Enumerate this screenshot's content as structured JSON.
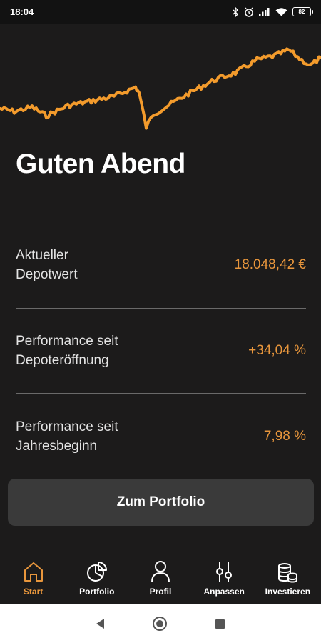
{
  "status_bar": {
    "time": "18:04",
    "battery": "82",
    "icons": [
      "bluetooth-icon",
      "alarm-icon",
      "signal-icon",
      "wifi-icon",
      "battery-icon"
    ]
  },
  "chart": {
    "line_color": "#f39b2c"
  },
  "greeting": "Guten Abend",
  "stats": [
    {
      "label_line1": "Aktueller",
      "label_line2": "Depotwert",
      "value": "18.048,42 €"
    },
    {
      "label_line1": "Performance seit",
      "label_line2": "Depoteröffnung",
      "value": "+34,04 %"
    },
    {
      "label_line1": "Performance seit",
      "label_line2": "Jahresbeginn",
      "value": "7,98 %"
    }
  ],
  "portfolio_button": "Zum Portfolio",
  "bottom_nav": {
    "active_index": 0,
    "items": [
      {
        "label": "Start",
        "icon": "home-icon"
      },
      {
        "label": "Portfolio",
        "icon": "pie-chart-icon"
      },
      {
        "label": "Profil",
        "icon": "person-icon"
      },
      {
        "label": "Anpassen",
        "icon": "sliders-icon"
      },
      {
        "label": "Investieren",
        "icon": "coins-icon"
      }
    ]
  },
  "colors": {
    "background": "#1c1b1b",
    "accent": "#e8963c",
    "button": "#3a3a3a"
  }
}
